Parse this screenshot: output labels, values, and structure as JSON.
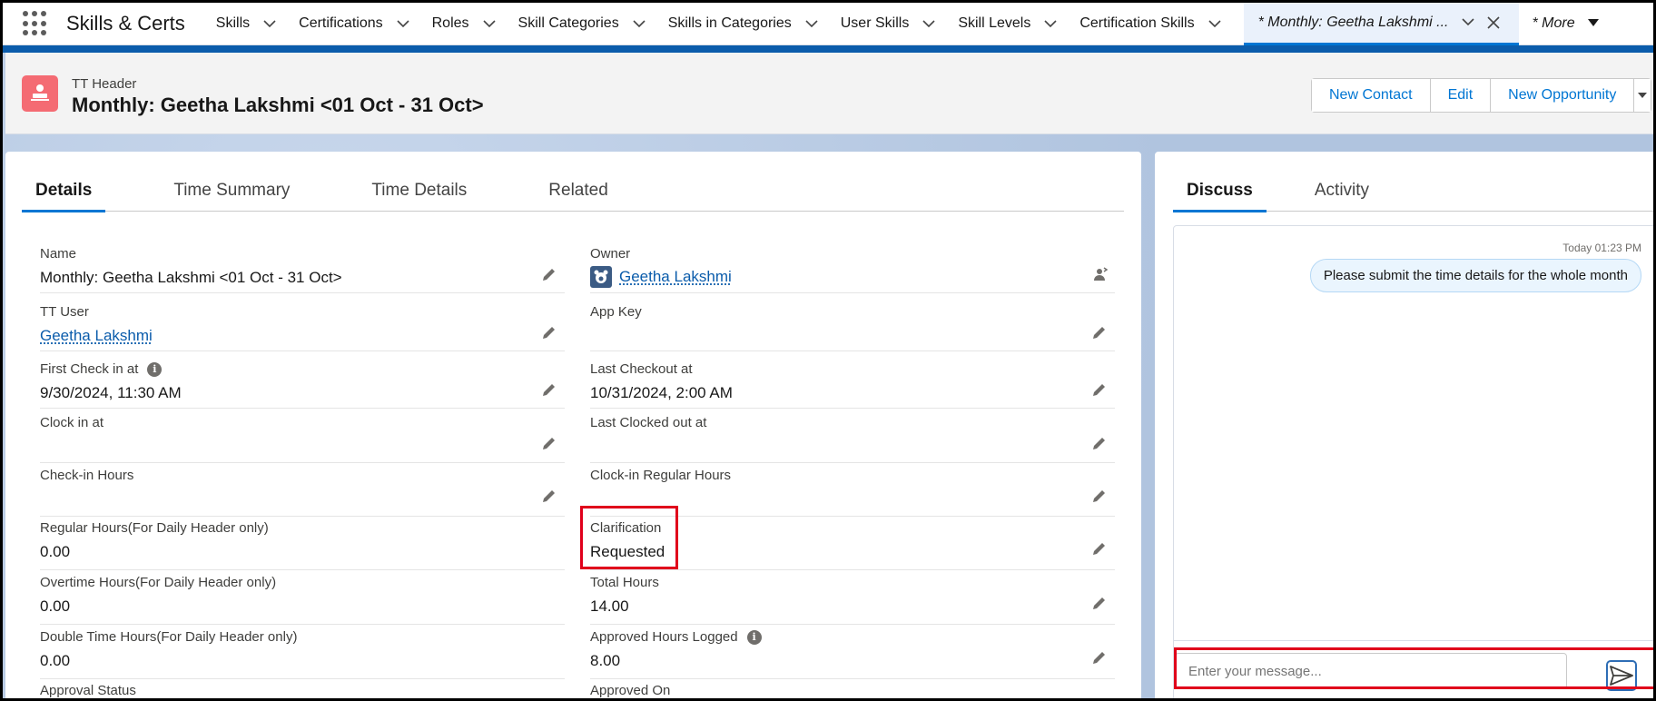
{
  "app": {
    "name": "Skills & Certs"
  },
  "nav": {
    "items": [
      {
        "label": "Skills"
      },
      {
        "label": "Certifications"
      },
      {
        "label": "Roles"
      },
      {
        "label": "Skill Categories"
      },
      {
        "label": "Skills in Categories"
      },
      {
        "label": "User Skills"
      },
      {
        "label": "Skill Levels"
      },
      {
        "label": "Certification Skills"
      }
    ],
    "active_tab": "* Monthly: Geetha Lakshmi ...",
    "more": "* More"
  },
  "header": {
    "subtitle": "TT Header",
    "title": "Monthly: Geetha Lakshmi <01 Oct - 31 Oct>",
    "buttons": [
      "New Contact",
      "Edit",
      "New Opportunity"
    ]
  },
  "tabs": [
    "Details",
    "Time Summary",
    "Time Details",
    "Related"
  ],
  "fields": {
    "name": {
      "label": "Name",
      "value": "Monthly: Geetha Lakshmi <01 Oct - 31 Oct>"
    },
    "owner": {
      "label": "Owner",
      "value": "Geetha Lakshmi"
    },
    "tt_user": {
      "label": "TT User",
      "value": "Geetha Lakshmi"
    },
    "app_key": {
      "label": "App Key",
      "value": ""
    },
    "first_check_in": {
      "label": "First Check in at",
      "value": "9/30/2024, 11:30 AM"
    },
    "last_checkout": {
      "label": "Last Checkout at",
      "value": "10/31/2024, 2:00 AM"
    },
    "clock_in": {
      "label": "Clock in at",
      "value": ""
    },
    "last_clocked_out": {
      "label": "Last Clocked out at",
      "value": ""
    },
    "check_in_hours": {
      "label": "Check-in Hours",
      "value": ""
    },
    "clock_in_regular": {
      "label": "Clock-in Regular Hours",
      "value": ""
    },
    "regular_hours": {
      "label": "Regular Hours(For Daily Header only)",
      "value": "0.00"
    },
    "clarification": {
      "label": "Clarification",
      "value": "Requested"
    },
    "overtime_hours": {
      "label": "Overtime Hours(For Daily Header only)",
      "value": "0.00"
    },
    "total_hours": {
      "label": "Total Hours",
      "value": "14.00"
    },
    "double_time": {
      "label": "Double Time Hours(For Daily Header only)",
      "value": "0.00"
    },
    "approved_hours": {
      "label": "Approved Hours Logged",
      "value": "8.00"
    },
    "approval_status": {
      "label": "Approval Status"
    },
    "approved_on": {
      "label": "Approved On"
    }
  },
  "discuss": {
    "tabs": [
      "Discuss",
      "Activity"
    ],
    "timestamp": "Today 01:23 PM",
    "message": "Please submit the time details for the whole month",
    "placeholder": "Enter your message..."
  },
  "colors": {
    "brand_blue": "#0176d3",
    "header_icon": "#f46b73",
    "highlight": "#e0001b"
  },
  "icons": {
    "app_launcher": "waffle-icon",
    "edit": "pencil-icon",
    "send": "send-icon",
    "change_owner": "change-owner-icon",
    "info": "info-icon"
  }
}
